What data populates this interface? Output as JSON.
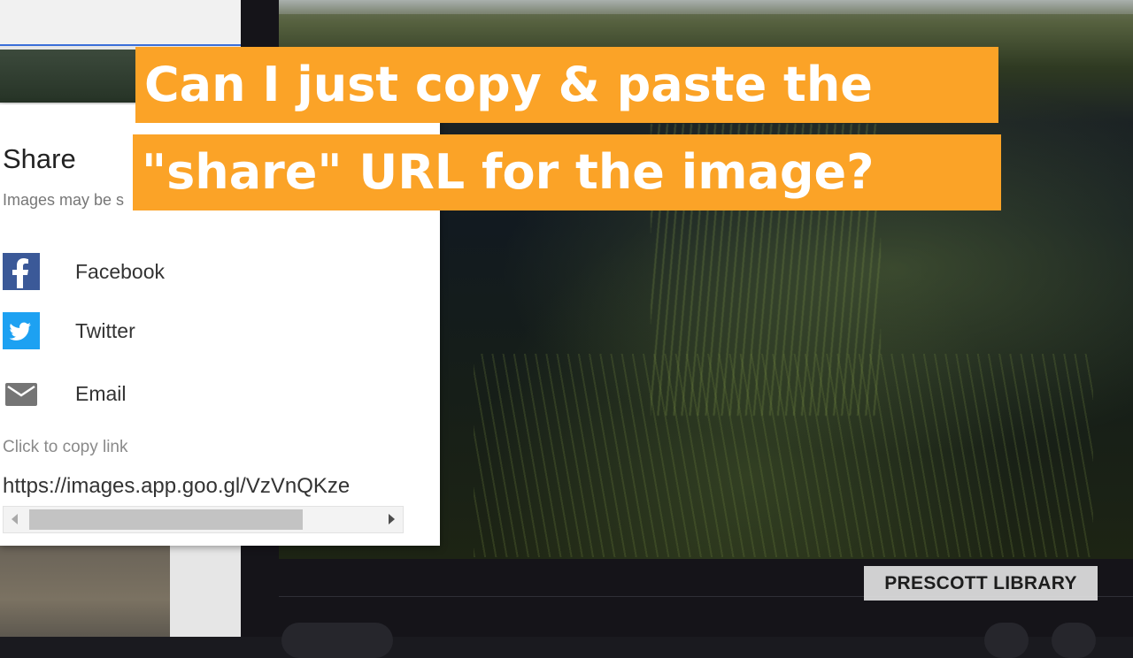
{
  "headline": {
    "line1": "Can I just copy & paste the",
    "line2": "\"share\" URL for the image?"
  },
  "share_dialog": {
    "title": "Share",
    "subtitle": "Images may be s",
    "options": [
      {
        "label": "Facebook",
        "icon": "facebook-icon",
        "color": "#3b5998"
      },
      {
        "label": "Twitter",
        "icon": "twitter-icon",
        "color": "#1da1f2"
      },
      {
        "label": "Email",
        "icon": "email-icon",
        "color": "#757575"
      }
    ],
    "copy_label": "Click to copy link",
    "url": "https://images.app.goo.gl/VzVnQKze"
  },
  "credit": "PRESCOTT LIBRARY",
  "colors": {
    "headline_bg": "#fba327",
    "headline_text": "#ffffff"
  }
}
